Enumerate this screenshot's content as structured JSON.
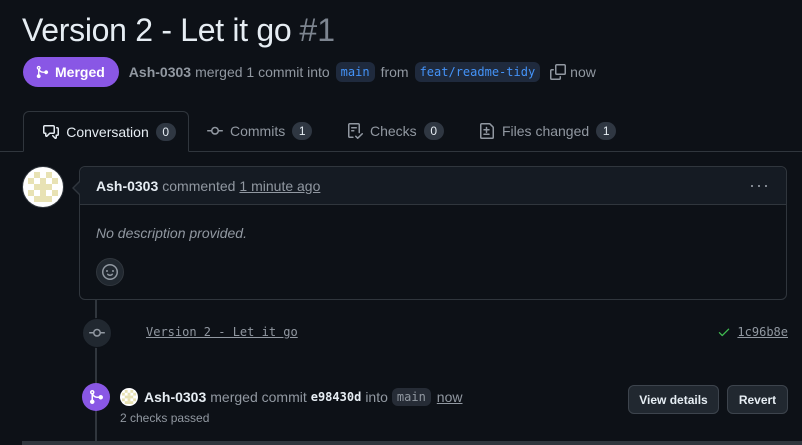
{
  "pr": {
    "title": "Version 2 - Let it go",
    "number": "#1",
    "state": "Merged",
    "author": "Ash-0303",
    "merged_text": "merged 1 commit into",
    "base_branch": "main",
    "from_text": "from",
    "head_branch": "feat/readme-tidy",
    "time": "now"
  },
  "tabs": [
    {
      "label": "Conversation",
      "count": "0",
      "icon": "comment-discussion-icon"
    },
    {
      "label": "Commits",
      "count": "1",
      "icon": "git-commit-icon"
    },
    {
      "label": "Checks",
      "count": "0",
      "icon": "checklist-icon"
    },
    {
      "label": "Files changed",
      "count": "1",
      "icon": "file-diff-icon"
    }
  ],
  "comment": {
    "author": "Ash-0303",
    "action": "commented",
    "time": "1 minute ago",
    "body": "No description provided."
  },
  "commit": {
    "message": "Version 2 - Let it go",
    "sha": "1c96b8e",
    "status": "success"
  },
  "merge_event": {
    "author": "Ash-0303",
    "action": "merged commit",
    "sha": "e98430d",
    "into_text": "into",
    "branch": "main",
    "time": "now",
    "checks": "2 checks passed",
    "view_details_label": "View details",
    "revert_label": "Revert"
  },
  "colors": {
    "background": "#0d1117",
    "merged_purple": "#8957e5",
    "link_blue": "#4493f8",
    "success_green": "#3fb950",
    "border": "#30363d"
  }
}
